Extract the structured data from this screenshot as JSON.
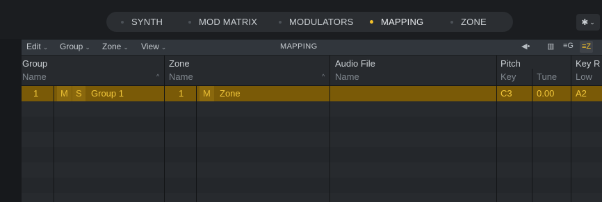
{
  "tabs": [
    {
      "label": "SYNTH",
      "active": false
    },
    {
      "label": "MOD MATRIX",
      "active": false
    },
    {
      "label": "MODULATORS",
      "active": false
    },
    {
      "label": "MAPPING",
      "active": true
    },
    {
      "label": "ZONE",
      "active": false
    }
  ],
  "gear_menu": {
    "icon": "gear-icon"
  },
  "toolbar": {
    "menus": [
      "Edit",
      "Group",
      "Zone",
      "View"
    ],
    "title": "MAPPING",
    "icons": [
      "speaker-icon",
      "keyboard-view-icon",
      "group-view-icon",
      "zone-view-icon"
    ]
  },
  "columns": {
    "group": {
      "title": "Group",
      "sub": "Name"
    },
    "zone": {
      "title": "Zone",
      "sub": "Name"
    },
    "audio": {
      "title": "Audio File",
      "sub": "Name"
    },
    "pitch": {
      "title": "Pitch",
      "sub_key": "Key",
      "sub_tune": "Tune"
    },
    "keyrange": {
      "title": "Key R",
      "sub": "Low"
    }
  },
  "rows": [
    {
      "group_num": "1",
      "group_m": "M",
      "group_s": "S",
      "group_name": "Group 1",
      "zone_num": "1",
      "zone_m": "M",
      "zone_name": "Zone",
      "audio": "",
      "key": "C3",
      "tune": "0.00",
      "low": "A2"
    }
  ],
  "colors": {
    "accent": "#f3c12a",
    "selected_row": "#7a5a07"
  }
}
